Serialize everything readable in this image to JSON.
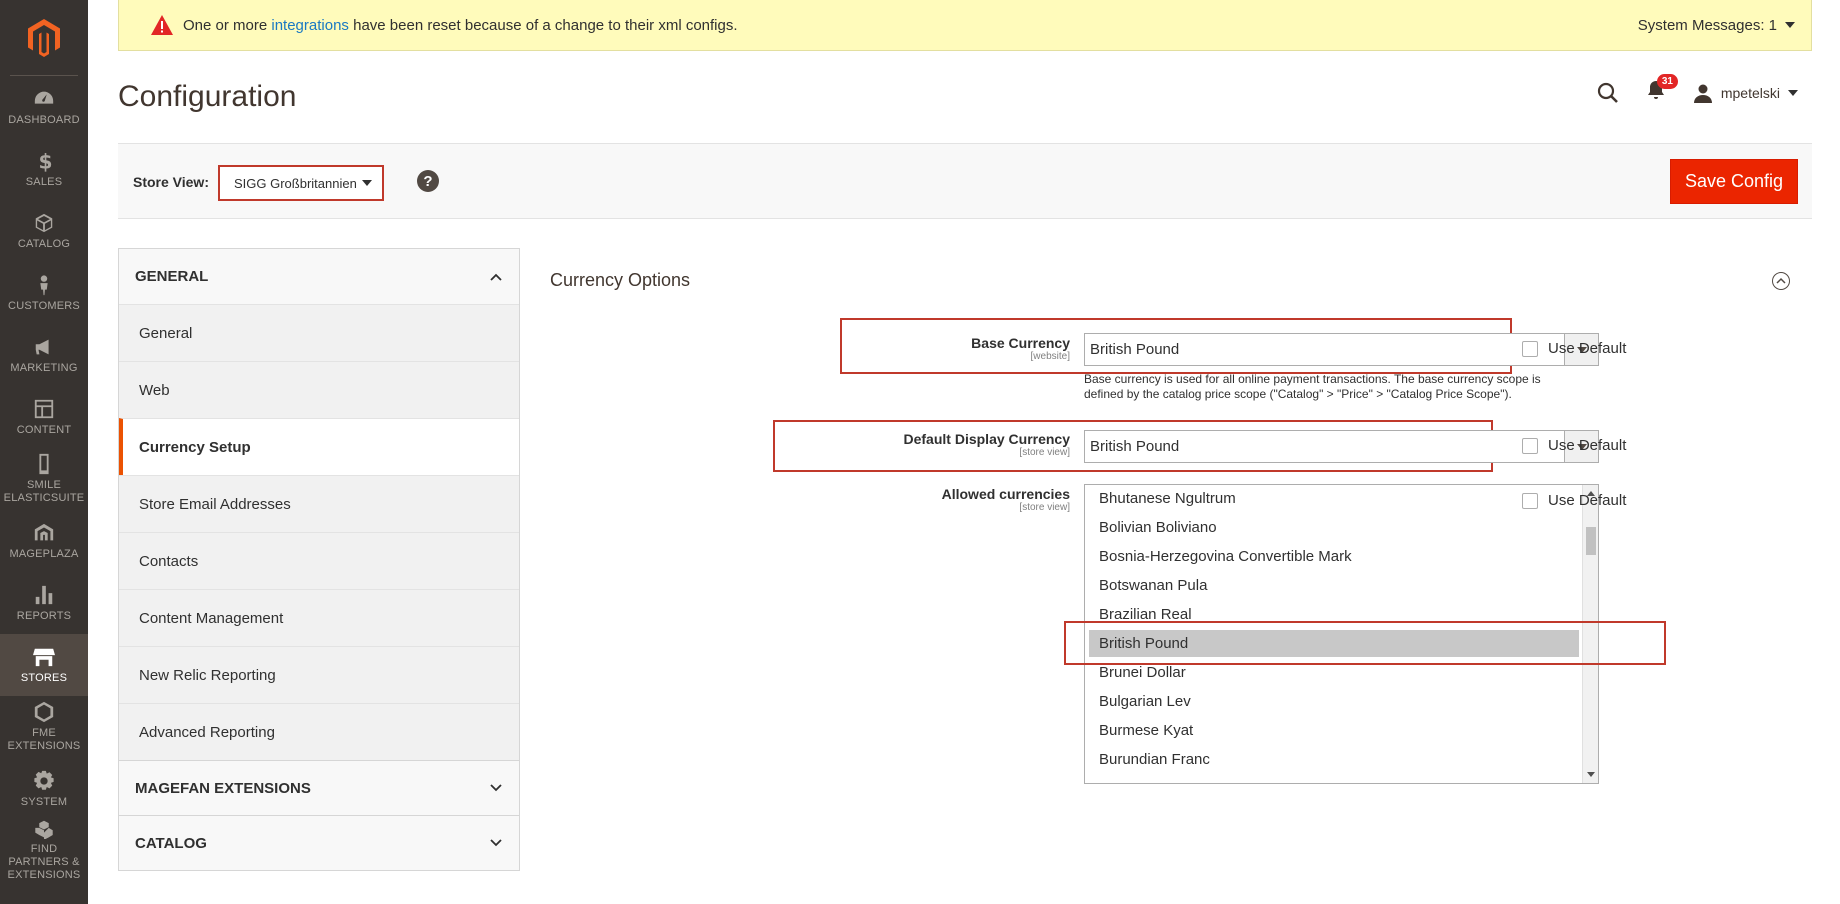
{
  "nav": {
    "items": [
      {
        "label": "Dashboard",
        "icon": "dashboard-icon"
      },
      {
        "label": "Sales",
        "icon": "dollar-icon"
      },
      {
        "label": "Catalog",
        "icon": "box-icon"
      },
      {
        "label": "Customers",
        "icon": "person-icon"
      },
      {
        "label": "Marketing",
        "icon": "megaphone-icon"
      },
      {
        "label": "Content",
        "icon": "layout-icon"
      },
      {
        "label": "Smile Elasticsuite",
        "icon": "phone-icon"
      },
      {
        "label": "Mageplaza",
        "icon": "mageplaza-icon"
      },
      {
        "label": "Reports",
        "icon": "bar-chart-icon"
      },
      {
        "label": "Stores",
        "icon": "store-icon",
        "active": true
      },
      {
        "label": "FME Extensions",
        "icon": "hexagon-icon"
      },
      {
        "label": "System",
        "icon": "gear-icon"
      },
      {
        "label": "Find Partners & Extensions",
        "icon": "cubes-icon"
      }
    ]
  },
  "system_message": {
    "prefix": "One or more ",
    "link": "integrations",
    "suffix": " have been reset because of a change to their xml configs.",
    "right_label": "System Messages: 1"
  },
  "header": {
    "title": "Configuration",
    "notifications_count": "31",
    "username": "mpetelski"
  },
  "toolbar": {
    "store_view_label": "Store View:",
    "store_view_value": "SIGG Großbritannien",
    "help_label": "?",
    "save_label": "Save Config"
  },
  "tabs": {
    "general_heading": "GENERAL",
    "general_items": [
      "General",
      "Web",
      "Currency Setup",
      "Store Email Addresses",
      "Contacts",
      "Content Management",
      "New Relic Reporting",
      "Advanced Reporting"
    ],
    "active_item": "Currency Setup",
    "magefan_heading": "MAGEFAN EXTENSIONS",
    "catalog_heading": "CATALOG"
  },
  "section": {
    "title": "Currency Options",
    "base_currency": {
      "label": "Base Currency",
      "scope": "[website]",
      "value": "British Pound",
      "note_line1": "Base currency is used for all online payment transactions. The base currency scope is",
      "note_line2": "defined by the catalog price scope (\"Catalog\" > \"Price\" > \"Catalog Price Scope\").",
      "use_default": "Use Default"
    },
    "display_currency": {
      "label": "Default Display Currency",
      "scope": "[store view]",
      "value": "British Pound",
      "use_default": "Use Default"
    },
    "allowed_currencies": {
      "label": "Allowed currencies",
      "scope": "[store view]",
      "options": [
        "Bhutanese Ngultrum",
        "Bolivian Boliviano",
        "Bosnia-Herzegovina Convertible Mark",
        "Botswanan Pula",
        "Brazilian Real",
        "British Pound",
        "Brunei Dollar",
        "Bulgarian Lev",
        "Burmese Kyat",
        "Burundian Franc"
      ],
      "selected": "British Pound",
      "use_default": "Use Default"
    }
  },
  "colors": {
    "accent": "#eb5202",
    "save_button": "#eb2500",
    "highlight_box": "#c0392b",
    "nav_background": "#373330",
    "message_background": "#fffbbb"
  }
}
